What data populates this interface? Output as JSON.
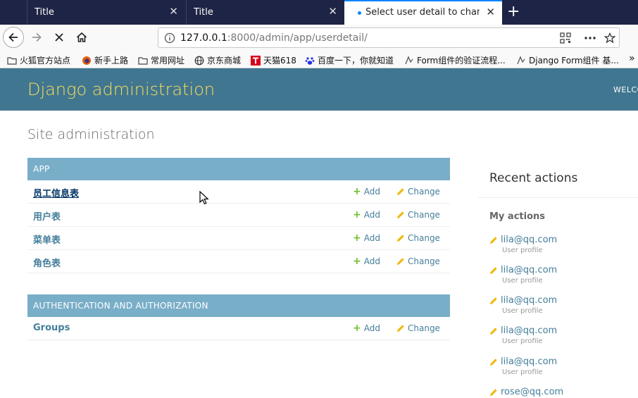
{
  "browser": {
    "tabs": [
      {
        "title": "Title",
        "close": "✕"
      },
      {
        "title": "Title",
        "close": "✕"
      },
      {
        "title": "Select user detail to change",
        "close": "✕"
      }
    ],
    "new_tab": "+",
    "url": {
      "host": "127.0.0.1",
      "rest": ":8000/admin/app/userdetail/"
    },
    "bookmarks": [
      "火狐官方站点",
      "新手上路",
      "常用网址",
      "京东商城",
      "天猫618",
      "百度一下，你就知道",
      "Form组件的验证流程...",
      "Django Form组件 基..."
    ],
    "bookmark_overflow": "»"
  },
  "header": {
    "brand": "Django administration",
    "welcome": "WELCOME,"
  },
  "page": {
    "title": "Site administration"
  },
  "modules": [
    {
      "caption": "APP",
      "rows": [
        {
          "name": "员工信息表",
          "add": "Add",
          "change": "Change"
        },
        {
          "name": "用户表",
          "add": "Add",
          "change": "Change"
        },
        {
          "name": "菜单表",
          "add": "Add",
          "change": "Change"
        },
        {
          "name": "角色表",
          "add": "Add",
          "change": "Change"
        }
      ]
    },
    {
      "caption": "AUTHENTICATION AND AUTHORIZATION",
      "rows": [
        {
          "name": "Groups",
          "add": "Add",
          "change": "Change"
        }
      ]
    }
  ],
  "recent": {
    "title": "Recent actions",
    "subtitle": "My actions",
    "items": [
      {
        "label": "lila@qq.com",
        "meta": "User profile"
      },
      {
        "label": "lila@qq.com",
        "meta": "User profile"
      },
      {
        "label": "lila@qq.com",
        "meta": "User profile"
      },
      {
        "label": "lila@qq.com",
        "meta": "User profile"
      },
      {
        "label": "lila@qq.com",
        "meta": "User profile"
      },
      {
        "label": "rose@qq.com",
        "meta": ""
      }
    ]
  },
  "colors": {
    "header_bg": "#417690",
    "brand": "#f5dd5d",
    "caption_bg": "#79aec8",
    "link": "#447e9b",
    "add_icon": "#70bf2b",
    "change_icon": "#efb80b"
  }
}
